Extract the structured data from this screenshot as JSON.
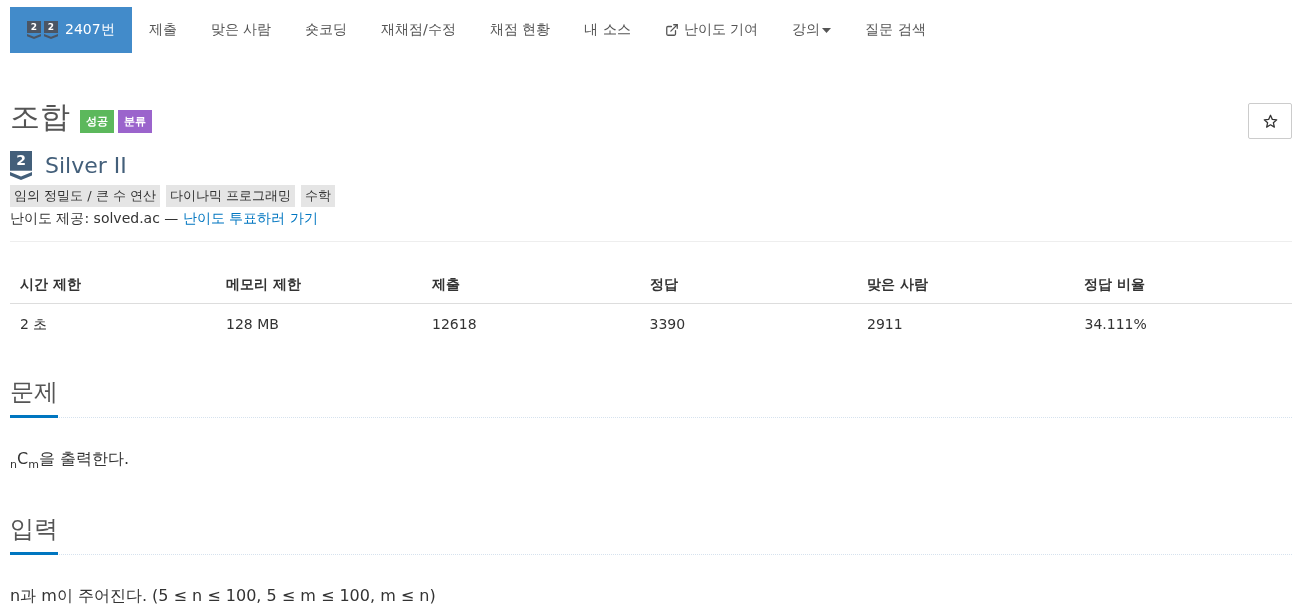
{
  "nav": {
    "items": [
      {
        "kind": "problem",
        "label": "2407번",
        "badges": [
          "2",
          "2"
        ],
        "selected": true
      },
      {
        "kind": "link",
        "label": "제출",
        "selected": false
      },
      {
        "kind": "link",
        "label": "맞은 사람",
        "selected": false
      },
      {
        "kind": "link",
        "label": "숏코딩",
        "selected": false
      },
      {
        "kind": "link",
        "label": "재채점/수정",
        "selected": false
      },
      {
        "kind": "link",
        "label": "채점 현황",
        "selected": false
      },
      {
        "kind": "link",
        "label": "내 소스",
        "selected": false
      },
      {
        "kind": "external",
        "label": "난이도 기여",
        "selected": false
      },
      {
        "kind": "dropdown",
        "label": "강의",
        "selected": false
      },
      {
        "kind": "link",
        "label": "질문 검색",
        "selected": false
      }
    ]
  },
  "problem": {
    "title": "조합",
    "labels": [
      {
        "label": "성공",
        "color": "#5cb85c"
      },
      {
        "label": "분류",
        "color": "#9b64cc"
      }
    ],
    "starred": false
  },
  "tier": {
    "rank": "2",
    "name": "Silver II"
  },
  "tags": [
    "임의 정밀도 / 큰 수 연산",
    "다이나믹 프로그래밍",
    "수학"
  ],
  "difficulty_credit": {
    "text": "난이도 제공: solved.ac — ",
    "link": "난이도 투표하러 가기"
  },
  "stats": {
    "columns": [
      "시간 제한",
      "메모리 제한",
      "제출",
      "정답",
      "맞은 사람",
      "정답 비율"
    ],
    "rows": [
      [
        "2 초",
        "128 MB",
        "12618",
        "3390",
        "2911",
        "34.111%"
      ]
    ]
  },
  "sections": [
    {
      "heading": "문제",
      "body": "$_{n}$C$_{m}$을 출력한다."
    },
    {
      "heading": "입력",
      "body": "n과 m이 주어진다. (5 ≤ n ≤ 100, 5 ≤ m ≤ 100, m ≤ n)"
    }
  ]
}
